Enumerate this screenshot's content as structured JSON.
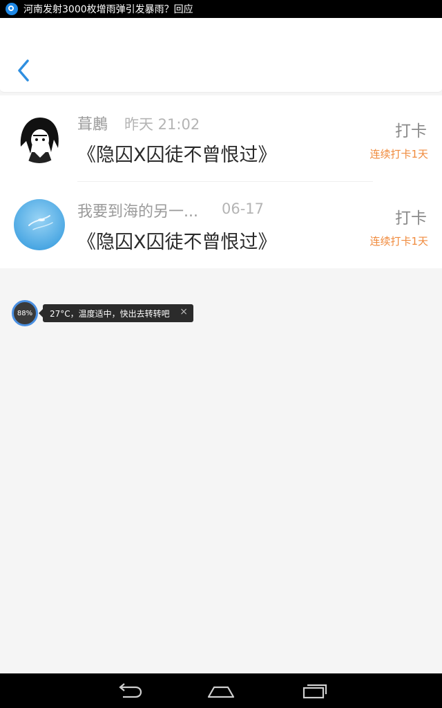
{
  "status_bar": {
    "notification_text": "河南发射3000枚增雨弹引发暴雨？回应",
    "icon": "qq-browser-icon"
  },
  "header": {
    "back_icon": "chevron-left-icon",
    "accent": "#2f8fe0"
  },
  "checkins": [
    {
      "name": "葺鶶",
      "time": "昨天 21:02",
      "title": "《隐囚X囚徒不曾恨过》",
      "checkin_label": "打卡",
      "streak": "连续打卡1天",
      "avatar_icon": "anime-girl-avatar"
    },
    {
      "name": "我要到海的另一...",
      "time": "06-17",
      "title": "《隐囚X囚徒不曾恨过》",
      "checkin_label": "打卡",
      "streak": "连续打卡1天",
      "avatar_icon": "sky-avatar"
    }
  ],
  "widget": {
    "battery": "88%",
    "tip": "27°C，温度适中，快出去转转吧",
    "close": "×"
  },
  "colors": {
    "orange": "#f08a3c",
    "blue": "#2f8fe0"
  },
  "nav": {
    "back_icon": "back-icon",
    "home_icon": "home-icon",
    "recents_icon": "recents-icon"
  }
}
